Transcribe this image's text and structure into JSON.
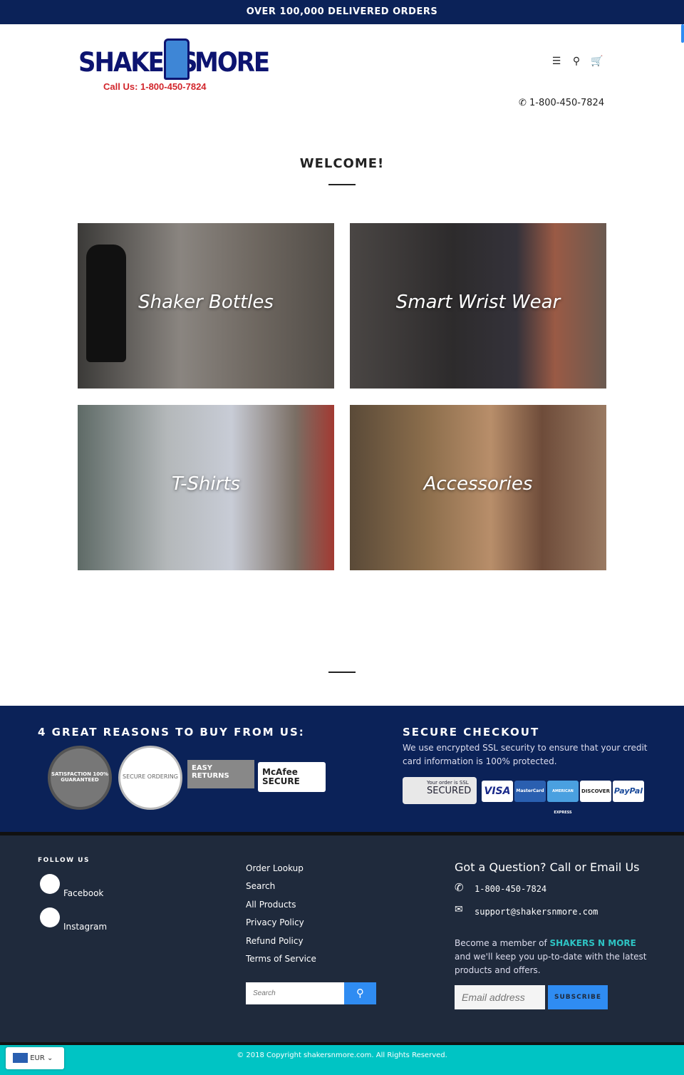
{
  "announcement": "OVER 100,000 DELIVERED ORDERS",
  "logo": {
    "text_left": "SHAKERS",
    "text_right": "MORE",
    "call": "Call Us: 1-800-450-7824"
  },
  "header": {
    "icons": [
      "menu-icon",
      "search-icon",
      "cart-icon"
    ],
    "phone": "1-800-450-7824"
  },
  "welcome": "WELCOME!",
  "collections": [
    {
      "label": "Shaker Bottles"
    },
    {
      "label": "Smart Wrist Wear"
    },
    {
      "label": "T-Shirts"
    },
    {
      "label": "Accessories"
    }
  ],
  "reasons": {
    "title": "4 GREAT REASONS TO BUY FROM US:",
    "badges": [
      "SATISFACTION 100% GUARANTEED",
      "SECURE ORDERING",
      "EASY RETURNS",
      "McAfee SECURE"
    ]
  },
  "checkout": {
    "title": "SECURE CHECKOUT",
    "text": "We use encrypted SSL security to ensure that your credit card information is 100% protected.",
    "ssl_top": "Your order is SSL",
    "ssl_bottom": "SECURED",
    "cards": [
      "VISA",
      "MasterCard",
      "AMERICAN EXPRESS",
      "DISCOVER",
      "PayPal"
    ]
  },
  "footer": {
    "follow_title": "FOLLOW US",
    "social": [
      "Facebook",
      "Instagram"
    ],
    "links": [
      "Order Lookup",
      "Search",
      "All Products",
      "Privacy Policy",
      "Refund Policy",
      "Terms of Service"
    ],
    "search_placeholder": "Search",
    "contact_title": "Got a Question? Call or Email Us",
    "phone": "1-800-450-7824",
    "email": "support@shakersnmore.com",
    "member_pre": "Become a member of ",
    "member_brand": "SHAKERS N MORE",
    "member_post": " and we'll keep you up-to-date with the latest products and offers.",
    "email_placeholder": "Email address",
    "subscribe": "SUBSCRIBE"
  },
  "copyright": "© 2018 Copyright shakersnmore.com. All Rights Reserved.",
  "currency": "EUR",
  "colors": {
    "navy": "#0b2258",
    "footer": "#1f2a3c",
    "teal": "#00c4c4",
    "accent": "#2f8cf2",
    "brand_teal": "#2ec4c4"
  }
}
